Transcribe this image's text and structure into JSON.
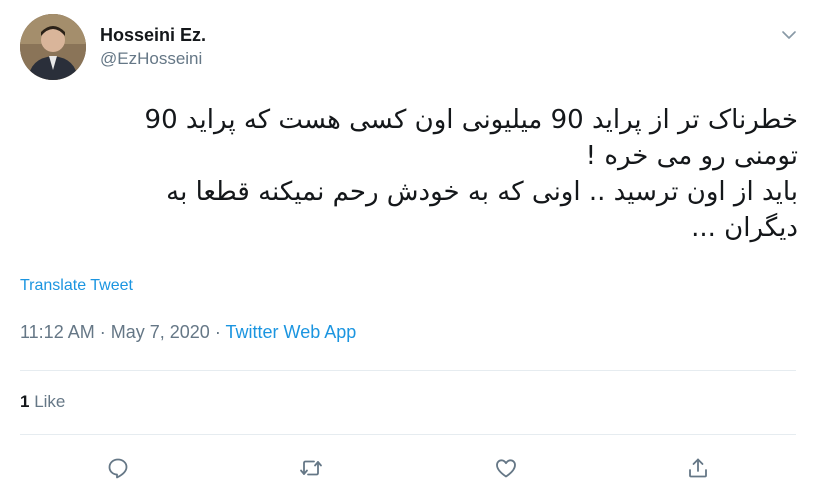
{
  "user": {
    "display_name": "Hosseini Ez.",
    "handle": "@EzHosseini"
  },
  "tweet": {
    "lines": [
      "خطرناک تر از پراید 90 میلیونی اون کسی هست که پراید 90",
      "تومنی رو می خره !",
      "باید از اون ترسید .. اونی که به خودش رحم نمیکنه قطعا به",
      "دیگران ..."
    ],
    "translate_label": "Translate Tweet",
    "time": "11:12 AM",
    "separator": "·",
    "date": "May 7, 2020",
    "source": "Twitter Web App"
  },
  "stats": {
    "like_count": "1",
    "like_label": "Like"
  },
  "icons": {
    "menu": "chevron-down-icon",
    "reply": "reply-icon",
    "retweet": "retweet-icon",
    "like": "heart-icon",
    "share": "share-icon"
  },
  "colors": {
    "link": "#1b95e0",
    "secondary_text": "#657786",
    "primary_text": "#14171a",
    "icon": "#657786",
    "divider": "#e6ecf0"
  }
}
